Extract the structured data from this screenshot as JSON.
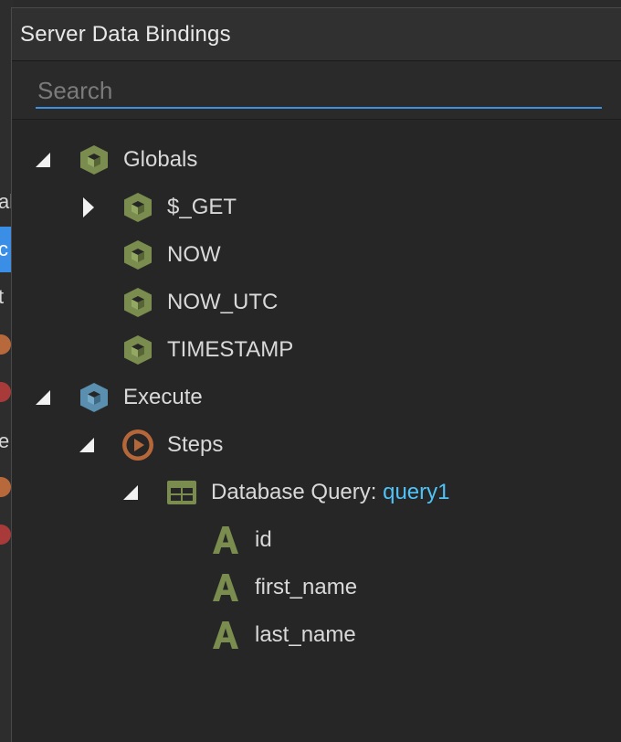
{
  "panel": {
    "title": "Server Data Bindings"
  },
  "search": {
    "placeholder": "Search",
    "value": ""
  },
  "background": {
    "fragments": [
      "al",
      "c",
      "t",
      "e"
    ]
  },
  "colors": {
    "accent_blue": "#3d8fe0",
    "binding_name": "#4fc3f7",
    "globals_icon": "#7a8c4e",
    "execute_icon": "#5a8fb0",
    "steps_icon": "#b5673a",
    "text_icon": "#7a8c4e"
  },
  "tree": {
    "globals": {
      "label": "Globals",
      "icon": "cube-icon",
      "expanded": true,
      "children": [
        {
          "label": "$_GET",
          "icon": "cube-icon",
          "expanded": false,
          "has_children": true
        },
        {
          "label": "NOW",
          "icon": "cube-icon"
        },
        {
          "label": "NOW_UTC",
          "icon": "cube-icon"
        },
        {
          "label": "TIMESTAMP",
          "icon": "cube-icon"
        }
      ]
    },
    "execute": {
      "label": "Execute",
      "icon": "cube-icon",
      "expanded": true,
      "steps": {
        "label": "Steps",
        "icon": "play-icon",
        "expanded": true,
        "query": {
          "label_prefix": "Database Query: ",
          "name": "query1",
          "icon": "table-icon",
          "expanded": true,
          "fields": [
            {
              "label": "id",
              "icon": "text-icon"
            },
            {
              "label": "first_name",
              "icon": "text-icon"
            },
            {
              "label": "last_name",
              "icon": "text-icon"
            }
          ]
        }
      }
    }
  }
}
